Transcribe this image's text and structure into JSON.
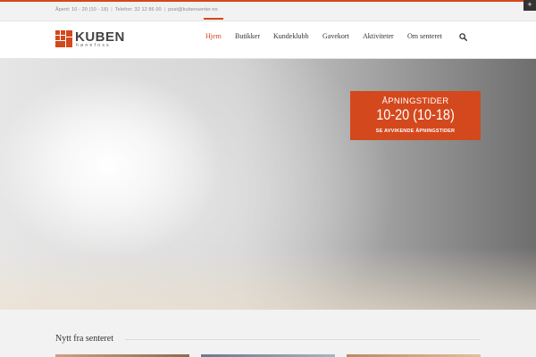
{
  "topbar": {
    "hours": "Åpent: 10 - 20 (10 - 18)",
    "phone": "Telefon: 32 12 86 00",
    "email": "post@kubensenter.no",
    "separator": "|"
  },
  "corner_toggle": {
    "symbol": "+"
  },
  "logo": {
    "name": "KUBEN",
    "subtitle": "hønefoss"
  },
  "nav": {
    "items": [
      {
        "label": "Hjem",
        "active": true
      },
      {
        "label": "Butikker",
        "active": false
      },
      {
        "label": "Kundeklubb",
        "active": false
      },
      {
        "label": "Gavekort",
        "active": false
      },
      {
        "label": "Aktiviteter",
        "active": false
      },
      {
        "label": "Om senteret",
        "active": false
      }
    ],
    "search_icon": "search-icon"
  },
  "hero": {
    "hours_box": {
      "title": "ÅPNINGSTIDER",
      "time": "10-20 (10-18)",
      "link": "SE AVVIKENDE ÅPNINGSTIDER"
    }
  },
  "news": {
    "title": "Nytt fra senteret"
  },
  "colors": {
    "accent": "#d4481d",
    "topbar_bg": "#f2f2f2",
    "text": "#333333"
  }
}
